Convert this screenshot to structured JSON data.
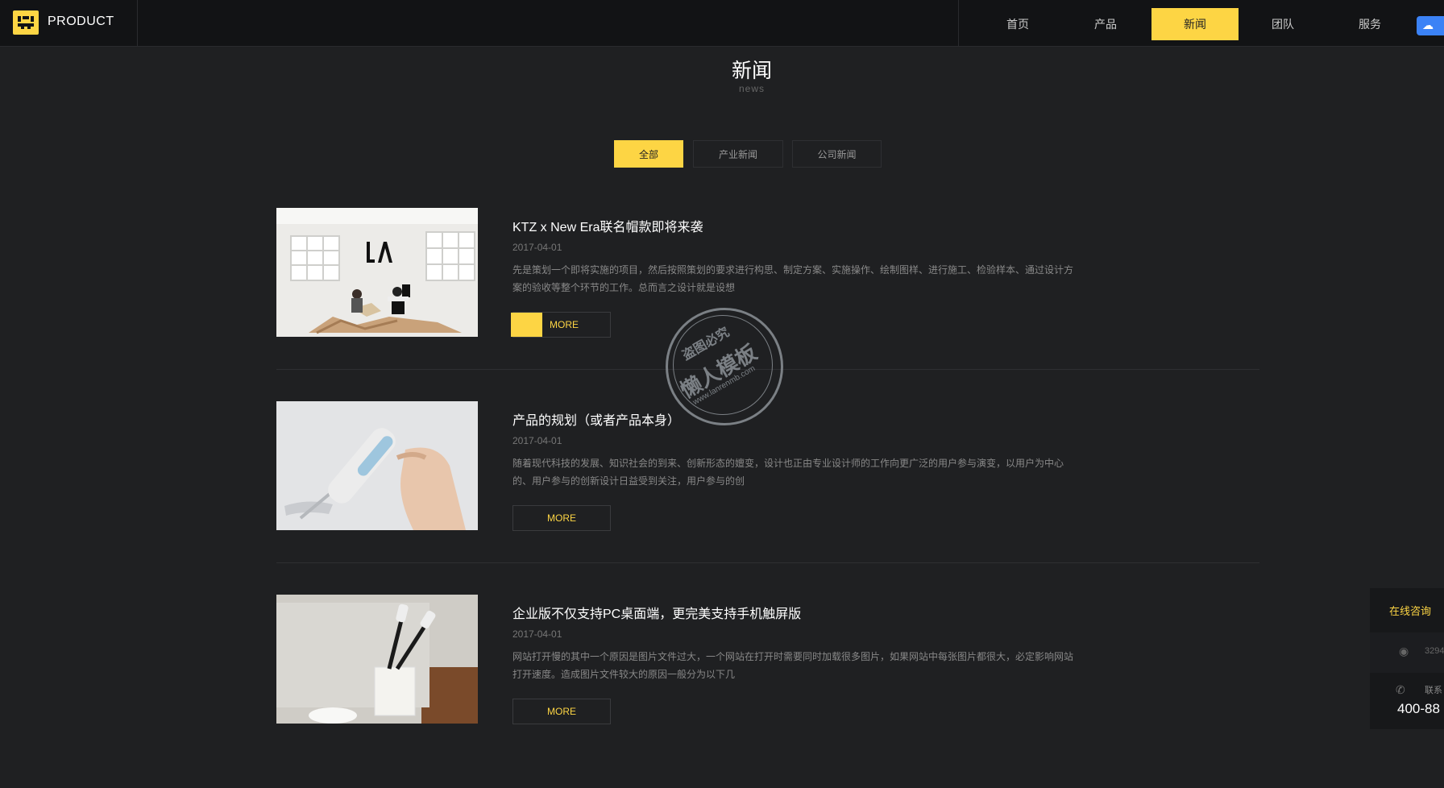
{
  "header": {
    "brand": "PRODUCT",
    "nav": [
      {
        "label": "首页"
      },
      {
        "label": "产品"
      },
      {
        "label": "新闻"
      },
      {
        "label": "团队"
      },
      {
        "label": "服务"
      }
    ]
  },
  "section": {
    "title": "新闻",
    "subtitle": "news"
  },
  "filters": [
    {
      "label": "全部"
    },
    {
      "label": "产业新闻"
    },
    {
      "label": "公司新闻"
    }
  ],
  "news": [
    {
      "title": "KTZ x New Era联名帽款即将来袭",
      "date": "2017-04-01",
      "desc": "先是策划一个即将实施的项目，然后按照策划的要求进行构思、制定方案、实施操作、绘制图样、进行施工、检验样本、通过设计方案的验收等整个环节的工作。总而言之设计就是设想",
      "more": "MORE"
    },
    {
      "title": "产品的规划（或者产品本身）",
      "date": "2017-04-01",
      "desc": "随着现代科技的发展、知识社会的到来、创新形态的嬗变，设计也正由专业设计师的工作向更广泛的用户参与演变，以用户为中心的、用户参与的创新设计日益受到关注，用户参与的创",
      "more": "MORE"
    },
    {
      "title": "企业版不仅支持PC桌面端，更完美支持手机触屏版",
      "date": "2017-04-01",
      "desc": "网站打开慢的其中一个原因是图片文件过大，一个网站在打开时需要同时加载很多图片，如果网站中每张图片都很大，必定影响网站打开速度。造成图片文件较大的原因一般分为以下几",
      "more": "MORE"
    }
  ],
  "watermark": {
    "line1": "盗图必究",
    "line2": "懒人模板",
    "line3": "www.lanrenmb.com"
  },
  "side_panel": {
    "title": "在线咨询",
    "qq": "3294",
    "contact": "联系",
    "phone": "400-88"
  },
  "colors": {
    "accent": "#fdd544",
    "background": "#1f2022",
    "header": "#121315"
  }
}
